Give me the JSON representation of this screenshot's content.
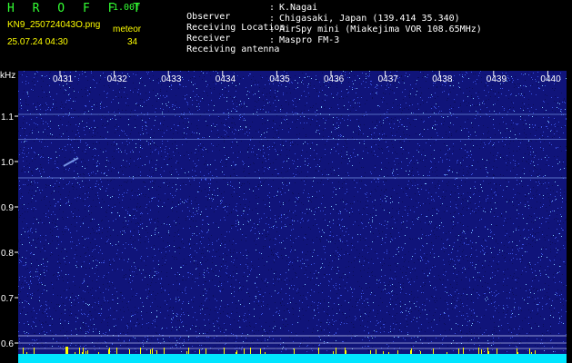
{
  "header": {
    "title": "H R O F F T",
    "version": "1.00f",
    "filename": "KN9_250724043O.png",
    "meteor_label": "meteor",
    "datetime": "25.07.24 04:30",
    "meteor_count": "34"
  },
  "info": [
    {
      "label": "Observer",
      "value": "K.Nagai"
    },
    {
      "label": "Receiving Location",
      "value": "Chigasaki, Japan (139.414 35.340)"
    },
    {
      "label": "Receiver",
      "value": "AirSpy mini (Miakejima VOR 108.65MHz)"
    },
    {
      "label": "Receiving antenna",
      "value": "Maspro FM-3"
    }
  ],
  "spectrogram": {
    "y_unit": "kHz",
    "y_ticks": [
      "1.1",
      "1.0",
      "0.9",
      "0.8",
      "0.7",
      "0.6"
    ],
    "x_ticks": [
      "0431",
      "0432",
      "0433",
      "0434",
      "0435",
      "0436",
      "0437",
      "0438",
      "0439",
      "0440"
    ],
    "colors": {
      "background": "#10147a",
      "noise_dark": "#0a0d5a",
      "noise_light": "#3a52e0",
      "noise_bright": "#7fc4ff",
      "axis": "#ffffff",
      "bottom_band": "#00e5ff",
      "tick_yellow": "#ffff00"
    }
  }
}
